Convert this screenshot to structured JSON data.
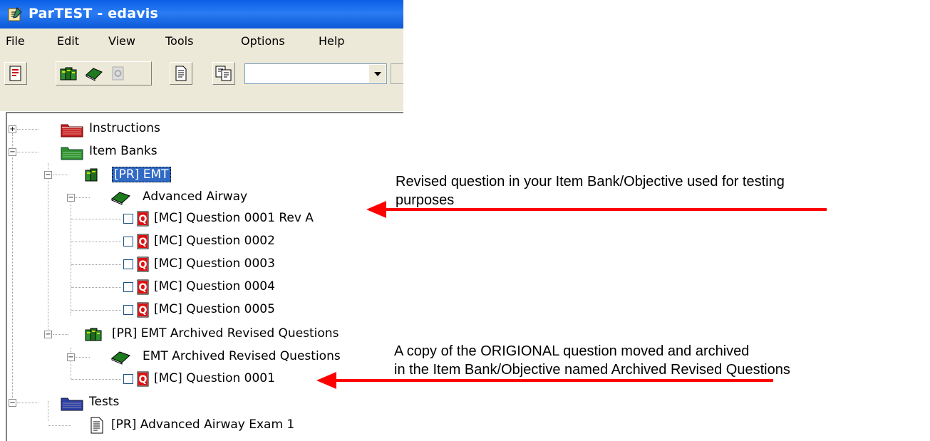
{
  "window": {
    "title": "ParTEST - edavis"
  },
  "menu": [
    "File",
    "Edit",
    "View",
    "Tools",
    "Options",
    "Help"
  ],
  "toolbar": {
    "combo_value": ""
  },
  "tree": {
    "instructions": "Instructions",
    "item_banks": "Item Banks",
    "bank_emt": "[PR] EMT",
    "objective_airway": "Advanced Airway",
    "questions": [
      "[MC] Question 0001 Rev A",
      "[MC] Question 0002",
      "[MC] Question 0003",
      "[MC] Question 0004",
      "[MC] Question 0005"
    ],
    "bank_archived": "[PR] EMT Archived Revised Questions",
    "objective_archived": "EMT Archived Revised Questions",
    "archived_question": "[MC] Question 0001",
    "tests": "Tests",
    "test_exam": "[PR] Advanced Airway Exam 1"
  },
  "annotations": {
    "note1_line1": "Revised question in your Item Bank/Objective used for testing",
    "note1_line2": "purposes",
    "note2_line1": "A copy of the ORIGIONAL question moved and archived",
    "note2_line2": "in the Item Bank/Objective named Archived Revised Questions"
  },
  "colors": {
    "title_bar": "#0a5fe6",
    "annotation_arrow": "#ff0000",
    "selection": "#316ac5"
  }
}
